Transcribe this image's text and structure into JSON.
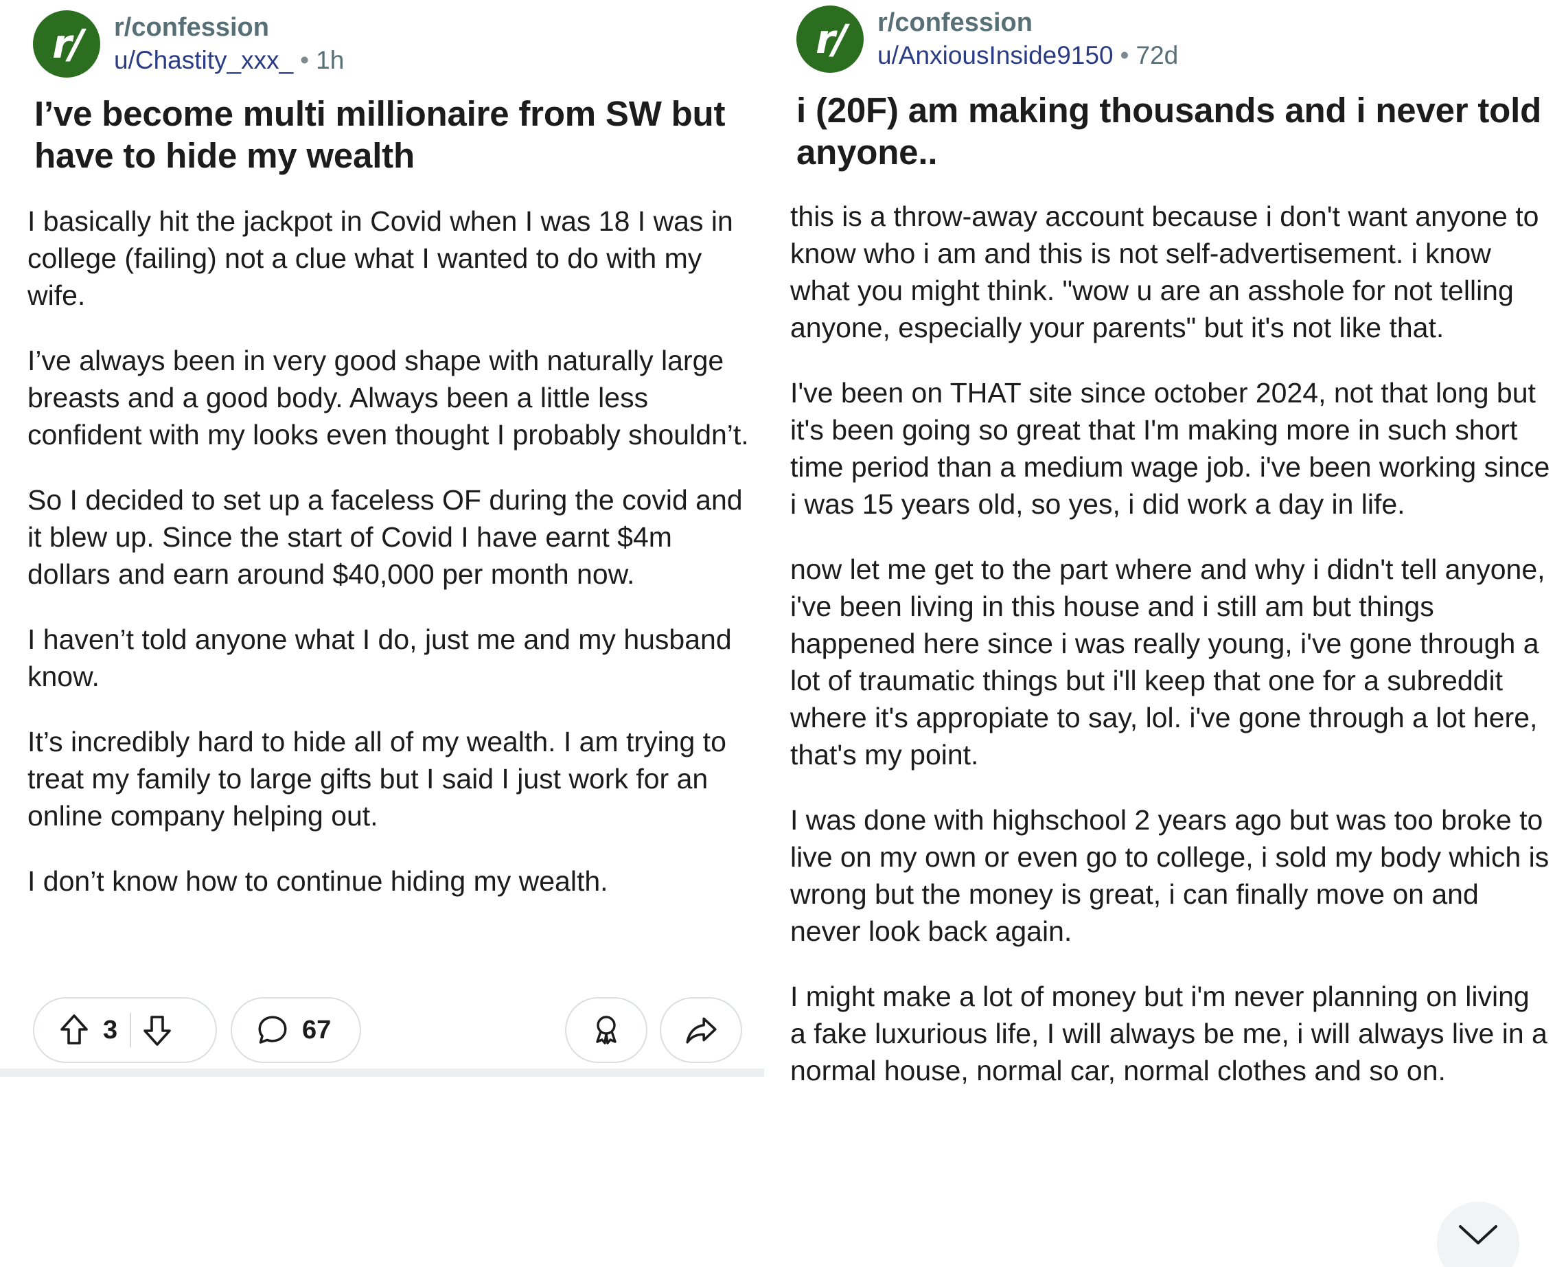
{
  "left_post": {
    "subreddit": "r/confession",
    "username": "u/Chastity_xxx_",
    "age": "1h",
    "title": "I’ve become multi millionaire from SW but have to hide my wealth",
    "paragraphs": [
      "I basically hit the jackpot in Covid when I was 18 I was in college (failing) not a clue what I wanted to do with my wife.",
      "I’ve always been in very good shape with naturally large breasts and a good body. Always been a little less confident with my looks even thought I probably shouldn’t.",
      "So I decided to set up a faceless OF during the covid and it blew up. Since the start of Covid I have earnt $4m dollars and earn around $40,000 per month now.",
      "I haven’t told anyone what I do, just me and my husband know.",
      "It’s incredibly hard to hide all of my wealth. I am trying to treat my family to large gifts but I said I just work for an online company helping out.",
      "I don’t know how to continue hiding my wealth."
    ],
    "upvotes": "3",
    "comments": "67"
  },
  "right_post": {
    "subreddit": "r/confession",
    "username": "u/AnxiousInside9150",
    "age": "72d",
    "title": "i (20F) am making thousands and i never told anyone..",
    "paragraphs": [
      "this is a throw-away account because i don't want anyone to know who i am and this is not self-advertisement. i know what you might think. \"wow u are an asshole for not telling anyone, especially your parents\" but it's not like that.",
      "I've been on THAT site since october 2024, not that long but it's been going so great that I'm making more in such short time period than a medium wage job. i've been working since i was 15 years old, so yes, i did work a day in life.",
      "now let me get to the part where and why i didn't tell anyone, i've been living in this house and i still am but things happened here since i was really young, i've gone through a lot of traumatic things but i'll keep that one for a subreddit where it's appropiate to say, lol. i've gone through a lot here, that's my point.",
      "I was done with highschool 2 years ago but was too broke to live on my own or even go to college, i sold my body which is wrong but the money is great, i can finally move on and never look back again.",
      "I might make a lot of money but i'm never planning on living a fake luxurious life, I will always be me, i will always live in a normal house, normal car, normal clothes and so on."
    ]
  },
  "icons": {
    "avatar": "r/",
    "upvote": "arrow-up-icon",
    "downvote": "arrow-down-icon",
    "comment": "comment-bubble-icon",
    "award": "award-icon",
    "share": "share-icon",
    "scroll": "chevron-down-icon"
  },
  "colors": {
    "avatar_bg": "#2c6e1f",
    "username": "#2a3c84",
    "meta_gray": "#576f76"
  }
}
